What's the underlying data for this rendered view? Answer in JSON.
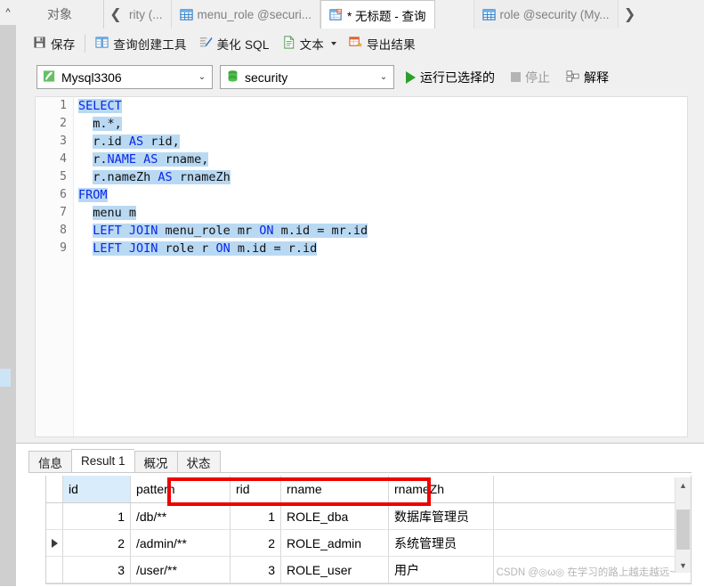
{
  "window": {
    "left_rail_collapse_icon": "chevron-up-icon"
  },
  "tabs": {
    "objects_label": "对象",
    "scroll_left_icon": "chevron-left-icon",
    "scroll_right_icon": "chevron-right-icon",
    "items": [
      {
        "label": "rity (...",
        "icon": "table-icon",
        "active": false,
        "clipped": true
      },
      {
        "label": "menu_role @securi...",
        "icon": "table-icon",
        "active": false,
        "clipped": false
      },
      {
        "label": "* 无标题 - 查询",
        "icon": "query-icon",
        "active": true,
        "clipped": false
      },
      {
        "label": "role @security (My...",
        "icon": "table-icon",
        "active": false,
        "clipped": false
      }
    ]
  },
  "toolbar": {
    "save_label": "保存",
    "save_icon": "save-icon",
    "query_builder_label": "查询创建工具",
    "query_builder_icon": "query-builder-icon",
    "beautify_label": "美化 SQL",
    "beautify_icon": "beautify-icon",
    "text_label": "文本",
    "text_icon": "text-file-icon",
    "text_dropdown_icon": "caret-down-icon",
    "export_label": "导出结果",
    "export_icon": "export-icon"
  },
  "connection_bar": {
    "server_value": "Mysql3306",
    "server_icon": "mysql-connection-icon",
    "server_dropdown_icon": "chevron-down-icon",
    "database_value": "security",
    "database_icon": "database-icon",
    "database_dropdown_icon": "chevron-down-icon",
    "run_selected_label": "运行已选择的",
    "run_icon": "play-icon",
    "stop_label": "停止",
    "stop_icon": "stop-icon",
    "explain_label": "解释",
    "explain_icon": "explain-icon"
  },
  "editor": {
    "lines": [
      {
        "no": "1",
        "indent": 0,
        "parts": [
          {
            "t": "SELECT",
            "k": true
          }
        ]
      },
      {
        "no": "2",
        "indent": 2,
        "parts": [
          {
            "t": "m.*,",
            "k": false
          }
        ]
      },
      {
        "no": "3",
        "indent": 2,
        "parts": [
          {
            "t": "r.id ",
            "k": false
          },
          {
            "t": "AS",
            "k": true
          },
          {
            "t": " rid,",
            "k": false
          }
        ]
      },
      {
        "no": "4",
        "indent": 2,
        "parts": [
          {
            "t": "r.",
            "k": false
          },
          {
            "t": "NAME AS",
            "k": true
          },
          {
            "t": " rname,",
            "k": false
          }
        ]
      },
      {
        "no": "5",
        "indent": 2,
        "parts": [
          {
            "t": "r.nameZh ",
            "k": false
          },
          {
            "t": "AS",
            "k": true
          },
          {
            "t": " rnameZh",
            "k": false
          }
        ]
      },
      {
        "no": "6",
        "indent": 0,
        "parts": [
          {
            "t": "FROM",
            "k": true
          }
        ]
      },
      {
        "no": "7",
        "indent": 2,
        "parts": [
          {
            "t": "menu m",
            "k": false
          }
        ]
      },
      {
        "no": "8",
        "indent": 2,
        "parts": [
          {
            "t": "LEFT JOIN",
            "k": true
          },
          {
            "t": " menu_role mr ",
            "k": false
          },
          {
            "t": "ON",
            "k": true
          },
          {
            "t": " m.id = mr.id",
            "k": false
          }
        ]
      },
      {
        "no": "9",
        "indent": 2,
        "parts": [
          {
            "t": "LEFT JOIN",
            "k": true
          },
          {
            "t": " role r ",
            "k": false
          },
          {
            "t": "ON",
            "k": true
          },
          {
            "t": " m.id = r.id",
            "k": false
          }
        ]
      }
    ]
  },
  "results": {
    "tabs": [
      {
        "label": "信息",
        "active": false
      },
      {
        "label": "Result 1",
        "active": true
      },
      {
        "label": "概况",
        "active": false
      },
      {
        "label": "状态",
        "active": false
      }
    ],
    "columns": [
      "id",
      "pattern",
      "rid",
      "rname",
      "rnameZh"
    ],
    "rows": [
      {
        "current": false,
        "id": "1",
        "pattern": "/db/**",
        "rid": "1",
        "rname": "ROLE_dba",
        "rnameZh": "数据库管理员"
      },
      {
        "current": true,
        "id": "2",
        "pattern": "/admin/**",
        "rid": "2",
        "rname": "ROLE_admin",
        "rnameZh": "系统管理员"
      },
      {
        "current": false,
        "id": "3",
        "pattern": "/user/**",
        "rid": "3",
        "rname": "ROLE_user",
        "rnameZh": "用户"
      }
    ],
    "scrollbar": {
      "up_icon": "chevron-up-icon",
      "down_icon": "chevron-down-icon"
    },
    "highlight_box_color": "#ee0000"
  },
  "watermark": {
    "text": "CSDN @◎ω◎ 在学习的路上越走越远~"
  }
}
